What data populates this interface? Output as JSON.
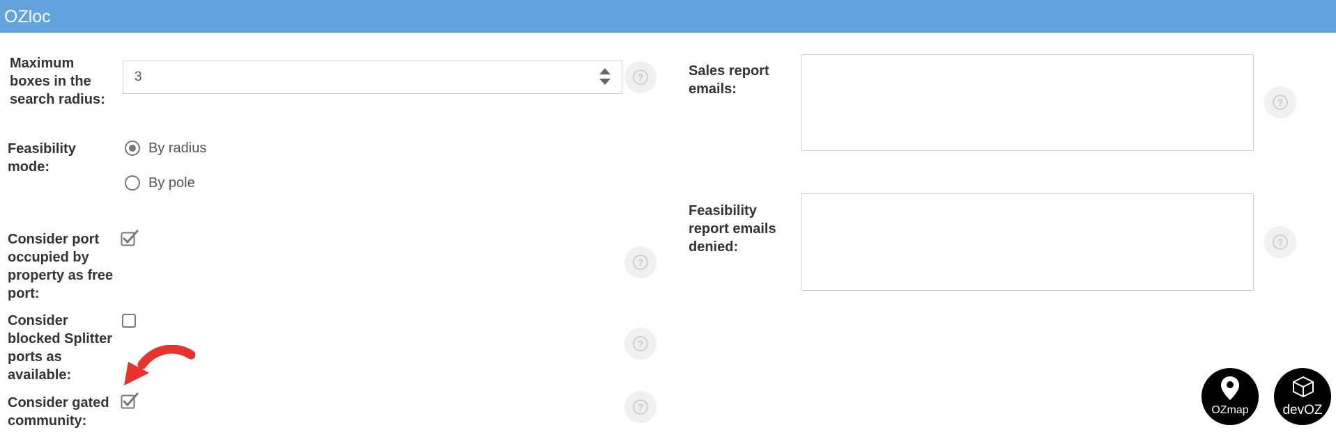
{
  "header": {
    "title": "OZloc"
  },
  "left": {
    "max_boxes": {
      "label": "Maximum boxes in the search radius:",
      "value": "3"
    },
    "feasibility_mode": {
      "label": "Feasibility mode:",
      "options": [
        {
          "label": "By radius",
          "selected": true
        },
        {
          "label": "By pole",
          "selected": false
        }
      ]
    },
    "port_occupied": {
      "label": "Consider port occupied by property as free port:",
      "checked": true
    },
    "blocked_splitter": {
      "label": "Consider blocked Splitter ports as available:",
      "checked": false
    },
    "gated_community": {
      "label": "Consider gated community:",
      "checked": true
    }
  },
  "right": {
    "sales_emails": {
      "label": "Sales report emails:",
      "value": ""
    },
    "feasibility_denied": {
      "label": "Feasibility report emails denied:",
      "value": ""
    }
  },
  "help_icon": "question-circle-icon",
  "logos": {
    "ozmap": "OZmap",
    "devoz": "devOZ"
  },
  "colors": {
    "header": "#62a3de",
    "arrow": "#e8322c"
  }
}
